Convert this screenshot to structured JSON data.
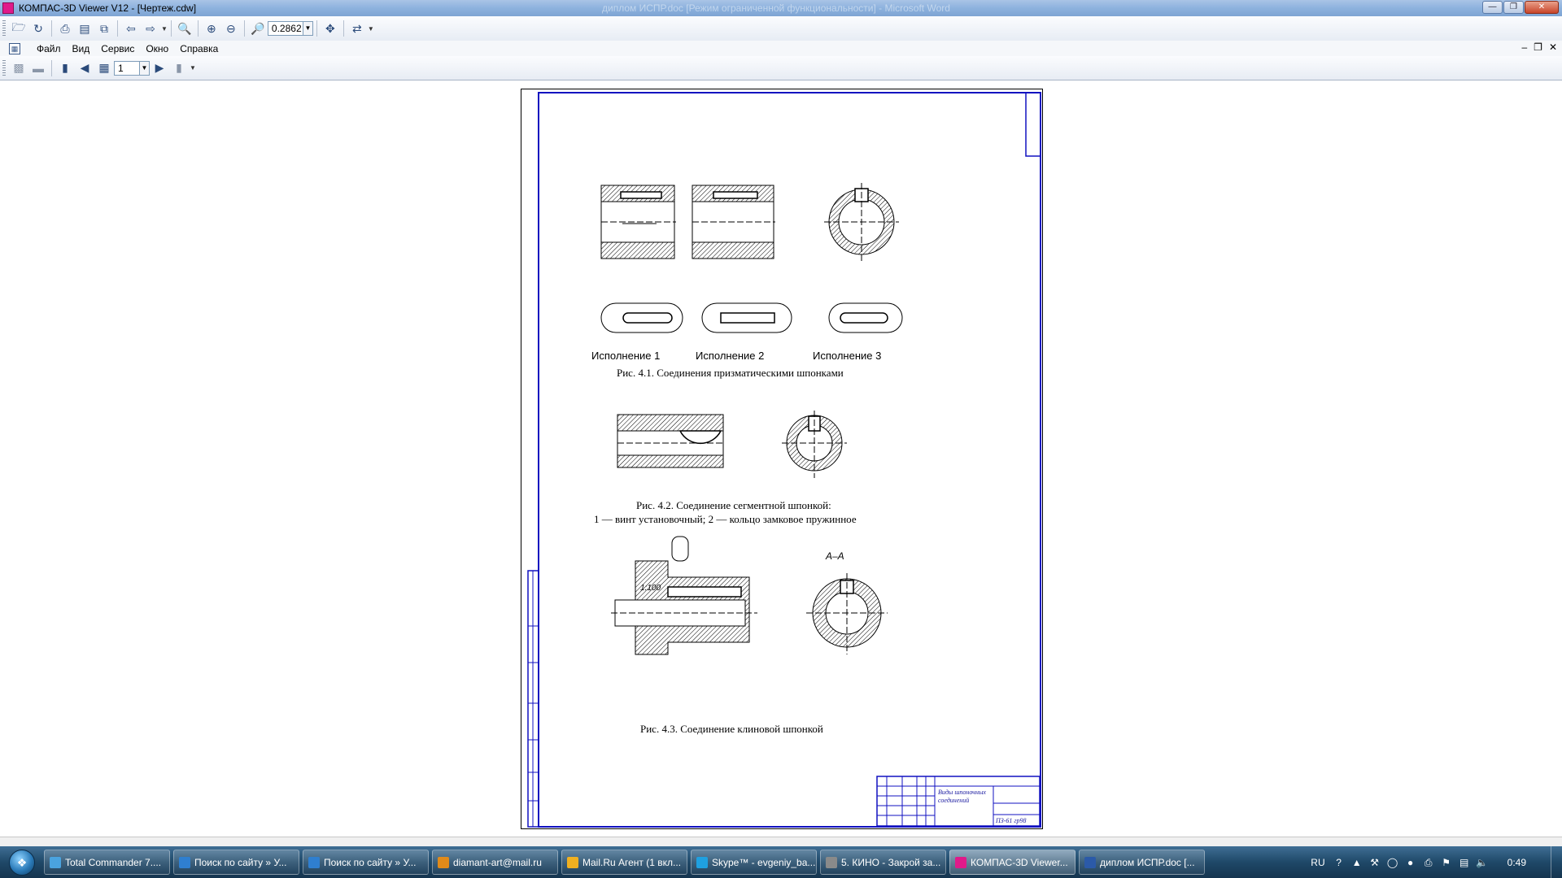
{
  "window": {
    "title": "КОМПАС-3D Viewer V12 - [Чертеж.cdw]",
    "background_title": "диплом ИСПР.doc [Режим ограниченной функциональности] - Microsoft Word"
  },
  "toolbar": {
    "zoom_value": "0.2862"
  },
  "menu": {
    "items": [
      "Файл",
      "Вид",
      "Сервис",
      "Окно",
      "Справка"
    ]
  },
  "toolbar2": {
    "page_value": "1"
  },
  "drawing": {
    "fig1_labels": [
      "Исполнение 1",
      "Исполнение 2",
      "Исполнение 3"
    ],
    "fig1_caption": "Рис.  4.1. Соединения призматическими шпонками",
    "fig2_caption_line1": "Рис. 4.2. Соединение сегментной шпонкой:",
    "fig2_caption_line2": "1 — винт установочный; 2 — кольцо замковое пружинное",
    "fig3_caption": "Рис. 4.3.   Соединение клиновой шпонкой",
    "fig3_section_label": "А–А",
    "fig3_taper_label": "1:100",
    "title_block_name": "Виды шпоночных соединений",
    "title_block_group": "ПЗ-61 гр98"
  },
  "taskbar": {
    "items": [
      {
        "label": "Total Commander 7....",
        "icon_color": "#4aa3df"
      },
      {
        "label": "Поиск по сайту » У...",
        "icon_color": "#2f7fd0"
      },
      {
        "label": "Поиск по сайту » У...",
        "icon_color": "#2f7fd0"
      },
      {
        "label": "diamant-art@mail.ru",
        "icon_color": "#e08a1a"
      },
      {
        "label": "Mail.Ru Агент (1 вкл...",
        "icon_color": "#f0b020"
      },
      {
        "label": "Skype™ - evgeniy_ba...",
        "icon_color": "#1fa0e0"
      },
      {
        "label": "5. КИНО - Закрой за...",
        "icon_color": "#8a8a8a"
      },
      {
        "label": "КОМПАС-3D Viewer...",
        "icon_color": "#e01a8a"
      },
      {
        "label": "диплом ИСПР.doc [...",
        "icon_color": "#2b5aa8"
      }
    ],
    "language": "RU",
    "clock": "0:49"
  }
}
